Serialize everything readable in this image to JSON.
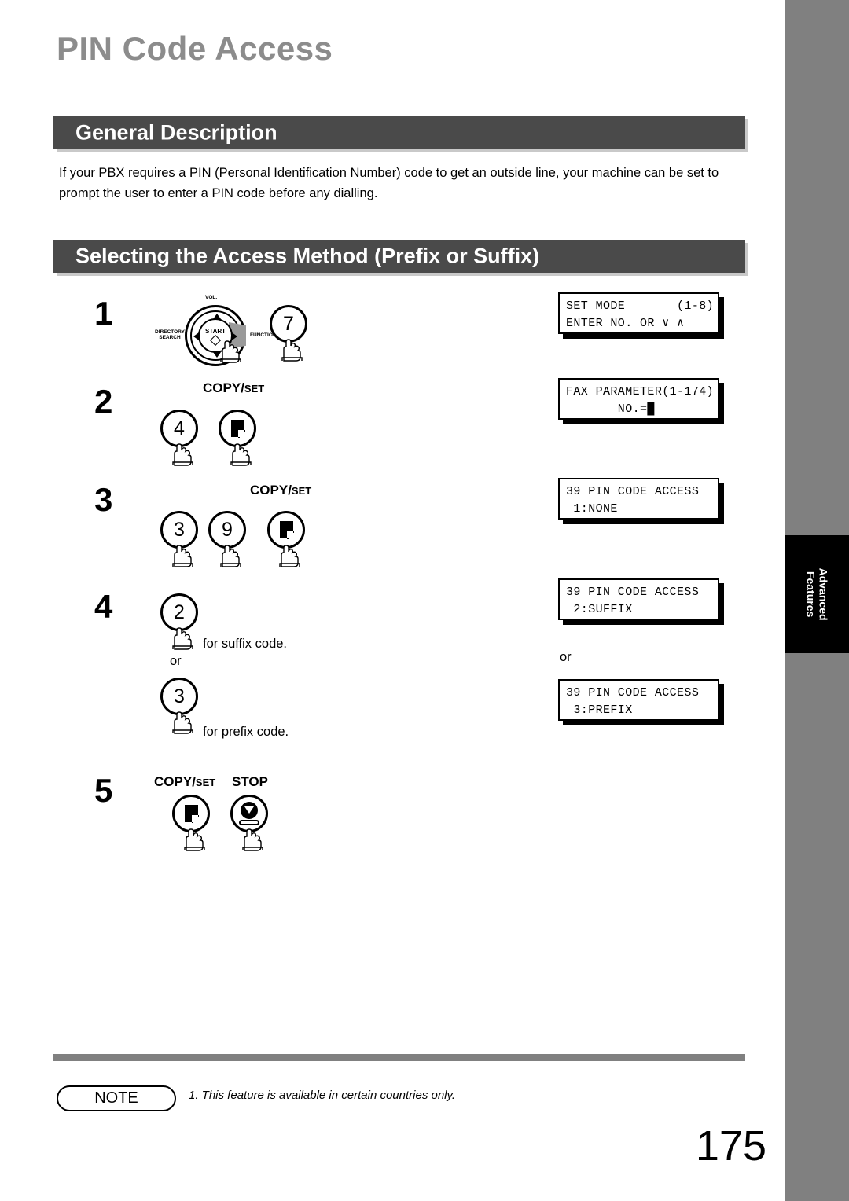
{
  "page": {
    "title": "PIN Code Access",
    "number": "175"
  },
  "sections": [
    {
      "id": "general",
      "heading": "General Description"
    },
    {
      "id": "selecting",
      "heading": "Selecting the Access Method (Prefix or Suffix)"
    }
  ],
  "general_description": {
    "paragraph": "If your PBX requires a PIN (Personal Identification Number) code to get an outside line, your machine can be set to prompt the user to enter a PIN code before any dialling."
  },
  "dial": {
    "center_label": "START",
    "top_label": "VOL.",
    "left_label": "DIRECTORY\nSEARCH",
    "left_label_1": "DIRECTORY",
    "left_label_2": "SEARCH",
    "right_label": "FUNCTION"
  },
  "steps": [
    {
      "number": "1",
      "keys": [
        "7"
      ],
      "key_group_label": "",
      "lcd": {
        "line1": "SET MODE       (1-8)",
        "line2": "ENTER NO. OR ∨ ∧"
      }
    },
    {
      "number": "2",
      "keys": [
        "4",
        "copy-set"
      ],
      "key_group_label_big": "COPY",
      "key_group_label_slash": "/",
      "key_group_label_small": "SET",
      "lcd": {
        "line1": "FAX PARAMETER(1-174)",
        "line2": "       NO.=█"
      }
    },
    {
      "number": "3",
      "keys": [
        "3",
        "9",
        "copy-set"
      ],
      "key_group_label_big": "COPY",
      "key_group_label_slash": "/",
      "key_group_label_small": "SET",
      "lcd": {
        "line1": "39 PIN CODE ACCESS",
        "line2": " 1:NONE"
      }
    },
    {
      "number": "4",
      "option_a": {
        "key": "2",
        "caption": "for suffix code.",
        "lcd": {
          "line1": "39 PIN CODE ACCESS",
          "line2": " 2:SUFFIX"
        }
      },
      "or_label": "or",
      "option_b": {
        "key": "3",
        "caption": "for prefix code.",
        "lcd": {
          "line1": "39 PIN CODE ACCESS",
          "line2": " 3:PREFIX"
        }
      }
    },
    {
      "number": "5",
      "keys": [
        "copy-set",
        "stop"
      ],
      "copy_label_big": "COPY",
      "copy_label_slash": "/",
      "copy_label_small": "SET",
      "stop_label": "STOP"
    }
  ],
  "side_tab": {
    "line1": "Advanced",
    "line2": "Features"
  },
  "footer": {
    "note_label": "NOTE",
    "note_text": "1.  This feature is available in certain countries only."
  },
  "colors": {
    "band": "#4a4a4a",
    "title": "#8c8c8c",
    "gutter": "#808080",
    "rule": "#808080"
  }
}
